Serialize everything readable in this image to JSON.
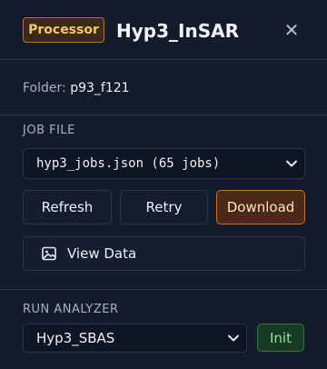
{
  "header": {
    "badge": "Processor",
    "title": "Hyp3_InSAR",
    "close_icon": "close-icon",
    "close_glyph": "✕"
  },
  "folder": {
    "label": "Folder:",
    "value": "p93_f121"
  },
  "job_file": {
    "section_label": "JOB FILE",
    "selected": "hyp3_jobs.json (65 jobs)",
    "chevron_icon": "chevron-down-icon"
  },
  "actions": {
    "refresh_label": "Refresh",
    "retry_label": "Retry",
    "download_label": "Download",
    "view_data_label": "View Data",
    "view_data_icon": "image-icon"
  },
  "run_analyzer": {
    "section_label": "RUN ANALYZER",
    "selected": "Hyp3_SBAS",
    "chevron_icon": "chevron-down-icon",
    "init_label": "Init"
  },
  "colors": {
    "background": "#141c2c",
    "badge_accent": "#b8741f",
    "download_accent": "#c9702a",
    "init_accent": "#2f7a3a"
  }
}
